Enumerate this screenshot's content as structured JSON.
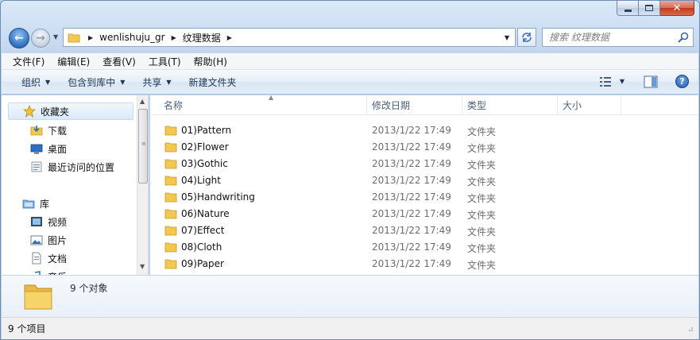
{
  "window": {
    "min_glyph": "minimize",
    "max_glyph": "maximize",
    "close_glyph": "x"
  },
  "nav": {
    "back_label": "back",
    "forward_label": "forward"
  },
  "address": {
    "crumbs": [
      "wenlishuju_gr",
      "纹理数据"
    ]
  },
  "search": {
    "placeholder": "搜索 纹理数据"
  },
  "menubar": {
    "items": [
      "文件(F)",
      "编辑(E)",
      "查看(V)",
      "工具(T)",
      "帮助(H)"
    ]
  },
  "cmdbar": {
    "organize": "组织",
    "include_library": "包含到库中",
    "share": "共享",
    "new_folder": "新建文件夹"
  },
  "navpane": {
    "favorites": "收藏夹",
    "downloads": "下载",
    "desktop": "桌面",
    "recent": "最近访问的位置",
    "libraries": "库",
    "videos": "视频",
    "pictures": "图片",
    "documents": "文档",
    "music": "音乐"
  },
  "columns": {
    "name": "名称",
    "modified": "修改日期",
    "type": "类型",
    "size": "大小"
  },
  "files": [
    {
      "name": "01)Pattern",
      "modified": "2013/1/22 17:49",
      "type": "文件夹"
    },
    {
      "name": "02)Flower",
      "modified": "2013/1/22 17:49",
      "type": "文件夹"
    },
    {
      "name": "03)Gothic",
      "modified": "2013/1/22 17:49",
      "type": "文件夹"
    },
    {
      "name": "04)Light",
      "modified": "2013/1/22 17:49",
      "type": "文件夹"
    },
    {
      "name": "05)Handwriting",
      "modified": "2013/1/22 17:49",
      "type": "文件夹"
    },
    {
      "name": "06)Nature",
      "modified": "2013/1/22 17:49",
      "type": "文件夹"
    },
    {
      "name": "07)Effect",
      "modified": "2013/1/22 17:49",
      "type": "文件夹"
    },
    {
      "name": "08)Cloth",
      "modified": "2013/1/22 17:49",
      "type": "文件夹"
    },
    {
      "name": "09)Paper",
      "modified": "2013/1/22 17:49",
      "type": "文件夹"
    }
  ],
  "details": {
    "count_text": "9 个对象"
  },
  "status": {
    "text": "9 个项目"
  },
  "colors": {
    "folder": "#f2c94c",
    "accent": "#2f6fc0",
    "close": "#c6391c"
  }
}
